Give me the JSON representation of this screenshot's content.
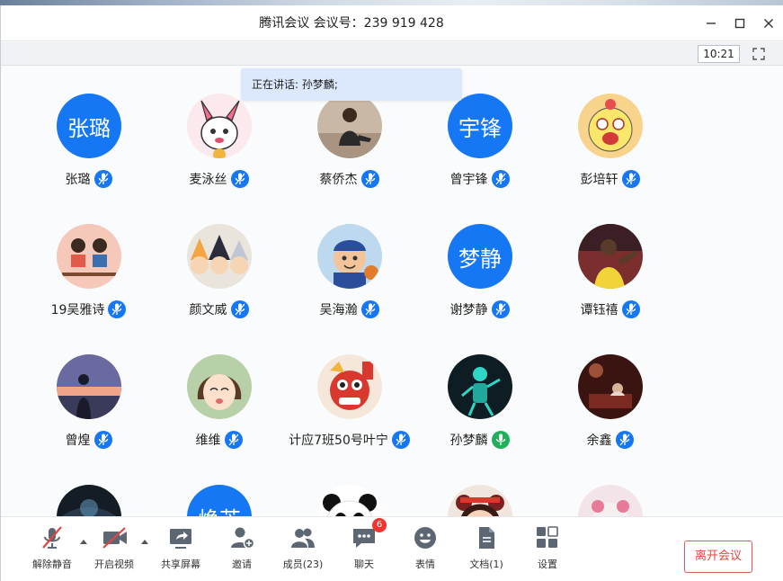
{
  "window": {
    "title": "腾讯会议 会议号：239 919 428"
  },
  "subbar": {
    "time": "10:21"
  },
  "speaking": {
    "text": "正在讲话: 孙梦麟;"
  },
  "participants": [
    {
      "name": "张璐",
      "avatar_text": "张璐",
      "avatar": "text",
      "mic_state": "muted"
    },
    {
      "name": "麦泳丝",
      "avatar_text": "",
      "avatar": "cartoon-bunny",
      "mic_state": "muted"
    },
    {
      "name": "蔡侨杰",
      "avatar_text": "",
      "avatar": "photo-person-sitting",
      "mic_state": "muted"
    },
    {
      "name": "曾宇锋",
      "avatar_text": "宇锋",
      "avatar": "text",
      "mic_state": "muted"
    },
    {
      "name": "彭培轩",
      "avatar_text": "",
      "avatar": "cartoon-face-dizzy",
      "mic_state": "muted"
    },
    {
      "name": "19吴雅诗",
      "avatar_text": "",
      "avatar": "cartoon-couple",
      "mic_state": "muted"
    },
    {
      "name": "颜文威",
      "avatar_text": "",
      "avatar": "anime-group",
      "mic_state": "muted"
    },
    {
      "name": "吴海瀚",
      "avatar_text": "",
      "avatar": "cartoon-basketball-kid",
      "mic_state": "muted"
    },
    {
      "name": "谢梦静",
      "avatar_text": "梦静",
      "avatar": "text",
      "mic_state": "muted"
    },
    {
      "name": "谭钰禧",
      "avatar_text": "",
      "avatar": "photo-football-player",
      "mic_state": "muted"
    },
    {
      "name": "曾煌",
      "avatar_text": "",
      "avatar": "sunset-silhouette",
      "mic_state": "muted"
    },
    {
      "name": "维维",
      "avatar_text": "",
      "avatar": "anime-girl",
      "mic_state": "muted"
    },
    {
      "name": "计应7班50号叶宁",
      "avatar_text": "",
      "avatar": "lion-dance",
      "mic_state": "muted"
    },
    {
      "name": "孙梦麟",
      "avatar_text": "",
      "avatar": "neon-robot",
      "mic_state": "speaking"
    },
    {
      "name": "余鑫",
      "avatar_text": "",
      "avatar": "dark-room",
      "mic_state": "muted"
    },
    {
      "name": "",
      "avatar_text": "",
      "avatar": "dark-night",
      "mic_state": "hidden"
    },
    {
      "name": "",
      "avatar_text": "焕芝",
      "avatar": "text",
      "mic_state": "hidden"
    },
    {
      "name": "",
      "avatar_text": "",
      "avatar": "panda",
      "mic_state": "hidden"
    },
    {
      "name": "",
      "avatar_text": "",
      "avatar": "doll",
      "mic_state": "hidden"
    },
    {
      "name": "",
      "avatar_text": "",
      "avatar": "pink-toy",
      "mic_state": "hidden"
    }
  ],
  "toolbar": {
    "unmute": "解除静音",
    "start_video": "开启视频",
    "share_screen": "共享屏幕",
    "invite": "邀请",
    "members": "成员(23)",
    "chat": "聊天",
    "chat_badge": "6",
    "reactions": "表情",
    "docs": "文档(1)",
    "settings": "设置",
    "leave": "离开会议"
  },
  "colors": {
    "accent": "#1677f5",
    "leave": "#e2453e",
    "badge": "#f0352e",
    "speaking_mic": "#20b05a"
  }
}
